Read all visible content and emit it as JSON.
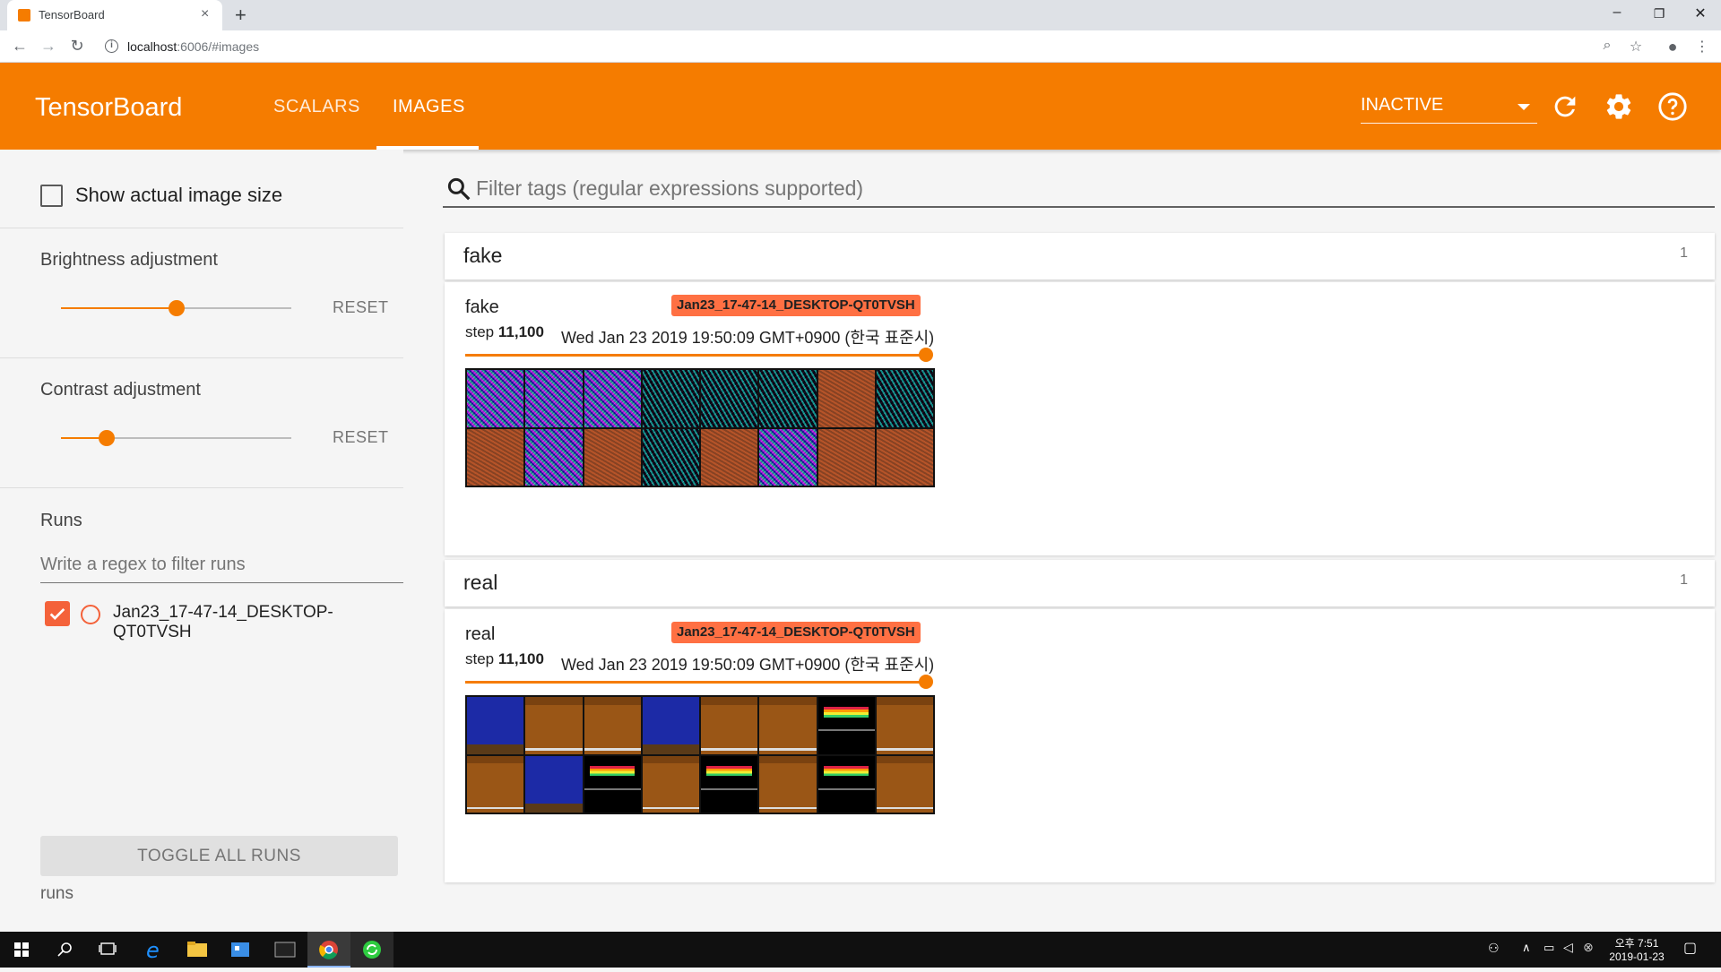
{
  "browser": {
    "tab_title": "TensorBoard",
    "tab_close": "×",
    "new_tab": "+",
    "url_host": "localhost",
    "url_rest": ":6006/#images",
    "window_controls": [
      "–",
      "❐",
      "✕"
    ]
  },
  "header": {
    "logo": "TensorBoard",
    "tabs": [
      {
        "label": "SCALARS",
        "active": false
      },
      {
        "label": "IMAGES",
        "active": true
      }
    ],
    "run_select": "INACTIVE",
    "accent_color": "#f57c00"
  },
  "sidebar": {
    "show_actual_size_label": "Show actual image size",
    "show_actual_size_checked": false,
    "brightness": {
      "label": "Brightness adjustment",
      "reset": "RESET",
      "value_fraction": 0.5
    },
    "contrast": {
      "label": "Contrast adjustment",
      "reset": "RESET",
      "value_fraction": 0.2
    },
    "runs_heading": "Runs",
    "runs_filter_placeholder": "Write a regex to filter runs",
    "runs": [
      {
        "name": "Jan23_17-47-14_DESKTOP-QT0TVSH",
        "checked": true,
        "color": "#f4623a"
      }
    ],
    "toggle_all": "TOGGLE ALL RUNS",
    "footer": "runs"
  },
  "main": {
    "tag_filter_placeholder": "Filter tags (regular expressions supported)",
    "panes": [
      {
        "title": "fake",
        "count": "1",
        "card": {
          "title": "fake",
          "run": "Jan23_17-47-14_DESKTOP-QT0TVSH",
          "step_label": "step",
          "step_value": "11,100",
          "time": "Wed Jan 23 2019 19:50:09 GMT+0900 (한국 표준시)"
        }
      },
      {
        "title": "real",
        "count": "1",
        "card": {
          "title": "real",
          "run": "Jan23_17-47-14_DESKTOP-QT0TVSH",
          "step_label": "step",
          "step_value": "11,100",
          "time": "Wed Jan 23 2019 19:50:09 GMT+0900 (한국 표준시)"
        }
      }
    ]
  },
  "taskbar": {
    "time": "오후 7:51",
    "date": "2019-01-23"
  }
}
